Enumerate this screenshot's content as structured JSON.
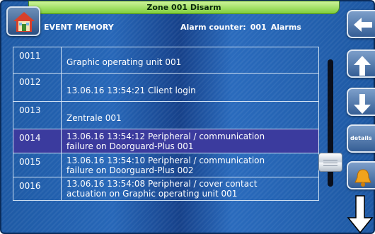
{
  "title": "Zone 001  Disarm",
  "header": {
    "section": "EVENT MEMORY",
    "counter_label": "Alarm counter:",
    "counter_value": "001",
    "counter_unit": "Alarms"
  },
  "events": [
    {
      "num": "0011",
      "text": "Graphic operating unit 001"
    },
    {
      "num": "0012",
      "text": "13.06.16 13:54:21  Client login"
    },
    {
      "num": "0013",
      "text": "Zentrale 001"
    },
    {
      "num": "0014",
      "line1": "13.06.16 13:54:12  Peripheral / communication",
      "line2": "failure on  Doorguard-Plus 001"
    },
    {
      "num": "0015",
      "line1": "13.06.16 13:54:10  Peripheral / communication",
      "line2": "failure on  Doorguard-Plus 002"
    },
    {
      "num": "0016",
      "line1": "13.06.16 13:54:08  Peripheral / cover contact",
      "line2": "actuation on  Graphic operating unit 001"
    }
  ],
  "selected_event": "0014",
  "buttons": {
    "details": "details"
  },
  "icons": {
    "home": "home-icon",
    "back": "back-arrow-icon",
    "up": "up-arrow-icon",
    "down": "down-arrow-icon",
    "alarm": "bell-icon",
    "scroll": "down-arrow-outline-icon"
  },
  "colors": {
    "title_bar": "#8fd94a",
    "selected_row": "#3b3b9e",
    "background": "#2262b0"
  }
}
